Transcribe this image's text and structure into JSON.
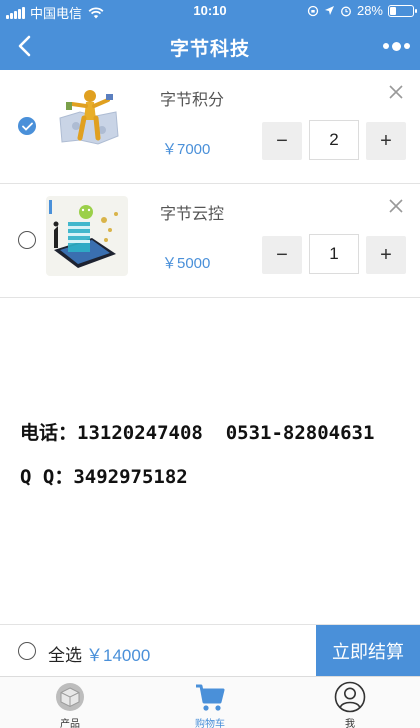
{
  "status_bar": {
    "carrier": "中国电信",
    "time": "10:10",
    "battery": "28%",
    "battery_level": 0.28
  },
  "nav": {
    "title": "字节科技",
    "back_icon": "back-chevron-icon",
    "more_icon": "more-dots-icon"
  },
  "cart": {
    "items": [
      {
        "name": "字节积分",
        "price": "￥7000",
        "quantity": "2",
        "checked": true,
        "minus": "−",
        "plus": "+",
        "image": "business-figure-puzzle-image"
      },
      {
        "name": "字节云控",
        "price": "￥5000",
        "quantity": "1",
        "checked": false,
        "minus": "−",
        "plus": "+",
        "image": "phone-cloud-control-image"
      }
    ]
  },
  "contact": {
    "phone_line": "电话：13120247408  0531-82804631",
    "qq_line": "Q Q：3492975182"
  },
  "checkout": {
    "select_all_label": "全选",
    "total": "￥14000",
    "button_label": "立即结算"
  },
  "tabbar": {
    "tabs": [
      {
        "label": "产品",
        "icon": "box-icon",
        "active": false
      },
      {
        "label": "购物车",
        "icon": "shopping-cart-icon",
        "active": true
      },
      {
        "label": "我",
        "icon": "user-icon",
        "active": false
      }
    ]
  },
  "colors": {
    "accent": "#4a90d9",
    "divider": "#e3e3e3",
    "stepper_bg": "#eeeeee"
  }
}
